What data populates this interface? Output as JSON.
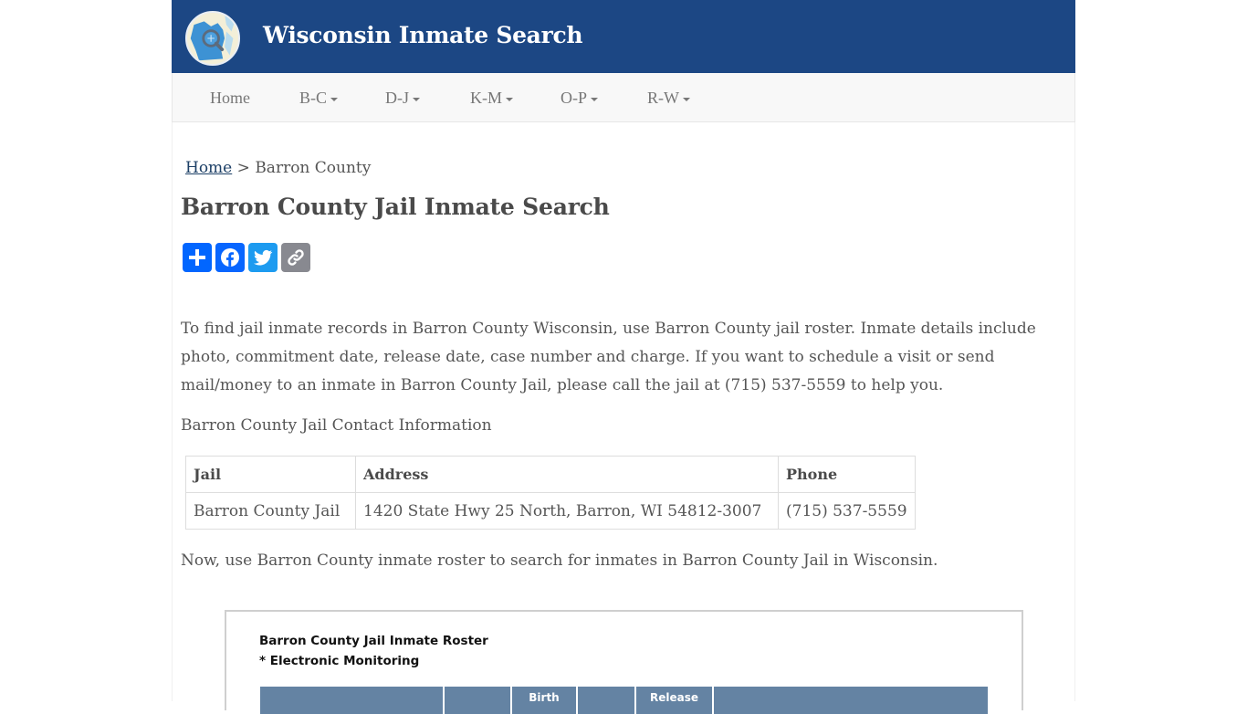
{
  "header": {
    "site_title": "Wisconsin Inmate Search",
    "logo_icon": "wisconsin-map-search-icon",
    "brand_color": "#1c4784"
  },
  "nav": {
    "items": [
      {
        "label": "Home",
        "dropdown": false
      },
      {
        "label": "B-C",
        "dropdown": true
      },
      {
        "label": "D-J",
        "dropdown": true
      },
      {
        "label": "K-M",
        "dropdown": true
      },
      {
        "label": "O-P",
        "dropdown": true
      },
      {
        "label": "R-W",
        "dropdown": true
      }
    ]
  },
  "breadcrumb": {
    "home_label": "Home",
    "separator": ">",
    "current": "Barron County"
  },
  "page_title": "Barron County Jail Inmate Search",
  "share": {
    "buttons": [
      {
        "name": "share",
        "icon": "plus-icon",
        "color": "#0166ff"
      },
      {
        "name": "facebook",
        "icon": "facebook-icon",
        "color": "#0866ff"
      },
      {
        "name": "twitter",
        "icon": "twitter-icon",
        "color": "#1d9bf0"
      },
      {
        "name": "copy-link",
        "icon": "link-icon",
        "color": "#888990"
      }
    ]
  },
  "intro_text": "To find jail inmate records in Barron County Wisconsin, use Barron County jail roster. Inmate details include photo, commitment date, release date, case number and charge. If you want to schedule a visit or send mail/money to an inmate in Barron County Jail, please call the jail at (715) 537-5559 to help you.",
  "contact_label": "Barron County Jail Contact Information",
  "contact_table": {
    "headers": [
      "Jail",
      "Address",
      "Phone"
    ],
    "rows": [
      [
        "Barron County Jail",
        "1420 State Hwy 25 North, Barron, WI 54812-3007",
        "(715) 537-5559"
      ]
    ]
  },
  "roster_intro": "Now, use Barron County inmate roster to search for inmates in Barron County Jail in Wisconsin.",
  "roster": {
    "title": "Barron County Jail Inmate Roster",
    "note": "* Electronic Monitoring",
    "header_color": "#6483a3",
    "columns": [
      "",
      "",
      "Birth",
      "",
      "Release",
      ""
    ]
  }
}
